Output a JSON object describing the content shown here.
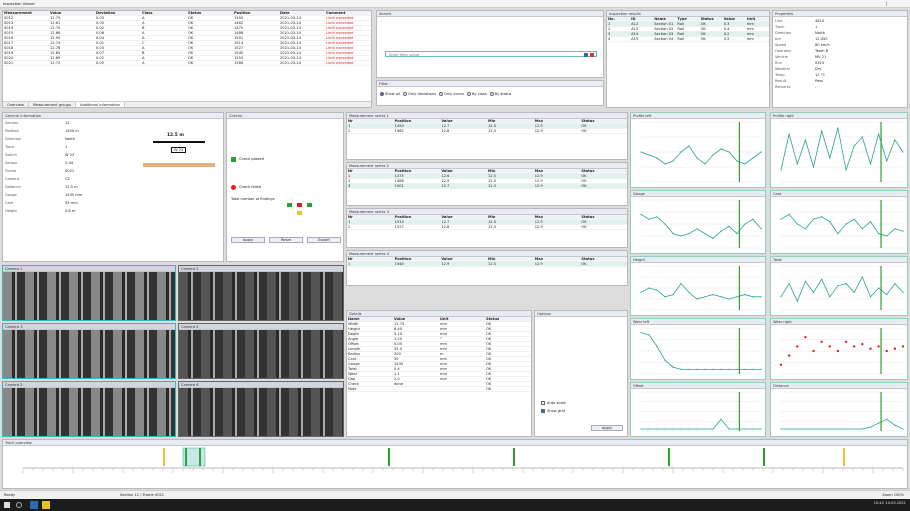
{
  "window": {
    "title": "Inspection Viewer"
  },
  "colors": {
    "teal": "#2aa391",
    "red": "#e02020",
    "green": "#2ca02c",
    "accent": "#2b6cb0"
  },
  "main_table": {
    "headers": [
      "Measurement",
      "Value",
      "Deviation",
      "Class",
      "Status",
      "Position",
      "Date",
      "Comment"
    ],
    "rows": [
      [
        "0012",
        "12.75",
        "0.03",
        "A",
        "OK",
        "1450",
        "2021-03-14",
        "Limit exceeded"
      ],
      [
        "0013",
        "12.81",
        "0.05",
        "A",
        "OK",
        "1462",
        "2021-03-14",
        "Limit exceeded"
      ],
      [
        "0014",
        "12.70",
        "0.02",
        "B",
        "OK",
        "1475",
        "2021-03-14",
        "Limit exceeded"
      ],
      [
        "0015",
        "12.66",
        "0.06",
        "A",
        "OK",
        "1488",
        "2021-03-14",
        "Limit exceeded"
      ],
      [
        "0016",
        "12.90",
        "0.04",
        "A",
        "OK",
        "1501",
        "2021-03-14",
        "Limit exceeded"
      ],
      [
        "0017",
        "12.74",
        "0.01",
        "C",
        "OK",
        "1514",
        "2021-03-14",
        "Limit exceeded"
      ],
      [
        "0018",
        "12.78",
        "0.03",
        "A",
        "OK",
        "1527",
        "2021-03-14",
        "Limit exceeded"
      ],
      [
        "0019",
        "12.85",
        "0.07",
        "B",
        "OK",
        "1540",
        "2021-03-14",
        "Limit exceeded"
      ],
      [
        "0020",
        "12.69",
        "0.02",
        "A",
        "OK",
        "1553",
        "2021-03-14",
        "Limit exceeded"
      ],
      [
        "0021",
        "12.72",
        "0.05",
        "A",
        "OK",
        "1566",
        "2021-03-14",
        "Limit exceeded"
      ]
    ],
    "tabs": [
      "Overview",
      "Measurement groups",
      "Additional information"
    ]
  },
  "search": {
    "title": "Search",
    "placeholder": "Enter filter value"
  },
  "filter_bar": {
    "title": "Filter",
    "options": [
      "Show all",
      "Only deviations",
      "Only errors",
      "By class",
      "By status"
    ]
  },
  "right_list": {
    "title": "Inspection results",
    "headers": [
      "No.",
      "ID",
      "Name",
      "Type",
      "Status",
      "Value",
      "Unit"
    ],
    "rows": [
      [
        "1",
        "A12",
        "Section 01",
        "Rail",
        "OK",
        "0.3",
        "mm"
      ],
      [
        "2",
        "A13",
        "Section 02",
        "Rail",
        "OK",
        "0.4",
        "mm"
      ],
      [
        "3",
        "A14",
        "Section 03",
        "Rail",
        "OK",
        "0.2",
        "mm"
      ],
      [
        "4",
        "A15",
        "Section 04",
        "Rail",
        "OK",
        "0.5",
        "mm"
      ]
    ]
  },
  "properties": {
    "title": "Properties",
    "items": [
      [
        "Line",
        "4810"
      ],
      [
        "Track",
        "1"
      ],
      [
        "Direction",
        "North"
      ],
      [
        "Km",
        "12.450"
      ],
      [
        "Speed",
        "80 km/h"
      ],
      [
        "Operator",
        "Team B"
      ],
      [
        "Vehicle",
        "MV 21"
      ],
      [
        "Run",
        "0315"
      ],
      [
        "Weather",
        "Dry"
      ],
      [
        "Temp.",
        "12 °C"
      ],
      [
        "Result",
        "Pass"
      ],
      [
        "Remarks",
        "-"
      ]
    ]
  },
  "info_panel": {
    "title": "General information",
    "items": [
      [
        "Section",
        "12"
      ],
      [
        "Position",
        "1450 m"
      ],
      [
        "Direction",
        "North"
      ],
      [
        "Track",
        "1"
      ],
      [
        "Switch",
        "W 23"
      ],
      [
        "Sensor",
        "S-04"
      ],
      [
        "Frame",
        "0021"
      ],
      [
        "Camera",
        "C2"
      ],
      [
        "Distance",
        "12.5 m"
      ],
      [
        "Gauge",
        "1435 mm"
      ],
      [
        "Cant",
        "35 mm"
      ],
      [
        "Height",
        "0.8 m"
      ]
    ],
    "distance_label": "12.5 m",
    "switch_label": "W 23"
  },
  "check_panel": {
    "title": "Checks",
    "ok_label": "Check passed",
    "warn_label": "Check failed",
    "summary_label": "Total number of findings",
    "button_a": "Apply",
    "button_b": "Reset",
    "button_c": "Export"
  },
  "mid_tables": [
    {
      "title": "Measurement series 1",
      "headers": [
        "Nr",
        "Position",
        "Value",
        "Min",
        "Max",
        "Status"
      ],
      "rows": [
        [
          "1",
          "1450",
          "12.7",
          "12.5",
          "12.9",
          "OK"
        ],
        [
          "2",
          "1462",
          "12.8",
          "12.5",
          "12.9",
          "OK"
        ]
      ]
    },
    {
      "title": "Measurement series 2",
      "headers": [
        "Nr",
        "Position",
        "Value",
        "Min",
        "Max",
        "Status"
      ],
      "rows": [
        [
          "1",
          "1475",
          "12.6",
          "12.5",
          "12.9",
          "OK"
        ],
        [
          "2",
          "1488",
          "12.9",
          "12.5",
          "12.9",
          "OK"
        ],
        [
          "3",
          "1501",
          "12.7",
          "12.5",
          "12.9",
          "OK"
        ]
      ]
    },
    {
      "title": "Measurement series 3",
      "headers": [
        "Nr",
        "Position",
        "Value",
        "Min",
        "Max",
        "Status"
      ],
      "rows": [
        [
          "1",
          "1514",
          "12.7",
          "12.5",
          "12.9",
          "OK"
        ],
        [
          "2",
          "1527",
          "12.8",
          "12.5",
          "12.9",
          "OK"
        ]
      ]
    },
    {
      "title": "Measurement series 4",
      "headers": [
        "Nr",
        "Position",
        "Value",
        "Min",
        "Max",
        "Status"
      ],
      "rows": [
        [
          "1",
          "1540",
          "12.9",
          "12.5",
          "12.9",
          "OK"
        ]
      ]
    }
  ],
  "bottom_table": {
    "title": "Details",
    "headers": [
      "Name",
      "Value",
      "Unit",
      "Status"
    ],
    "rows": [
      [
        "Width",
        "12.75",
        "mm",
        "OK"
      ],
      [
        "Height",
        "8.40",
        "mm",
        "OK"
      ],
      [
        "Depth",
        "3.10",
        "mm",
        "OK"
      ],
      [
        "Angle",
        "1.20",
        "°",
        "OK"
      ],
      [
        "Offset",
        "0.05",
        "mm",
        "OK"
      ],
      [
        "Length",
        "52.0",
        "mm",
        "OK"
      ],
      [
        "Radius",
        "300",
        "m",
        "OK"
      ],
      [
        "Cant",
        "35",
        "mm",
        "OK"
      ],
      [
        "Gauge",
        "1435",
        "mm",
        "OK"
      ],
      [
        "Twist",
        "0.4",
        "mm",
        "OK"
      ],
      [
        "Wear",
        "1.1",
        "mm",
        "OK"
      ],
      [
        "Gap",
        "2.0",
        "mm",
        "OK"
      ],
      [
        "Check",
        "done",
        "",
        "OK"
      ],
      [
        "Note",
        "-",
        "",
        "OK"
      ]
    ]
  },
  "options_panel": {
    "title": "Options",
    "option_a": "Auto scale",
    "option_b": "Show grid",
    "button": "Apply"
  },
  "image_titles": [
    "Camera 1",
    "Camera 2",
    "Camera 3",
    "Camera 4",
    "Camera 5",
    "Camera 6"
  ],
  "chart_titles": [
    "Profile left",
    "Profile right",
    "Gauge",
    "Cant",
    "Height",
    "Twist",
    "Wear left",
    "Wear right",
    "Offset",
    "Distance"
  ],
  "chart_data": [
    {
      "type": "line",
      "title": "Profile left",
      "values": [
        0.5,
        0.45,
        0.4,
        0.3,
        0.35,
        0.5,
        0.6,
        0.4,
        0.3,
        0.45,
        0.55,
        0.5,
        0.35,
        0.3,
        0.4,
        0.5
      ]
    },
    {
      "type": "line",
      "title": "Profile right",
      "values": [
        0.2,
        0.8,
        0.3,
        0.7,
        0.25,
        0.85,
        0.4,
        0.9,
        0.2,
        0.6,
        0.75,
        0.3,
        0.8,
        0.35,
        0.7,
        0.5
      ]
    },
    {
      "type": "line",
      "title": "Gauge",
      "values": [
        0.7,
        0.6,
        0.65,
        0.5,
        0.3,
        0.25,
        0.3,
        0.4,
        0.3,
        0.2,
        0.35,
        0.45,
        0.3,
        0.5,
        0.6,
        0.4
      ]
    },
    {
      "type": "line",
      "title": "Cant",
      "values": [
        0.6,
        0.7,
        0.5,
        0.4,
        0.6,
        0.65,
        0.55,
        0.3,
        0.5,
        0.6,
        0.4,
        0.55,
        0.3,
        0.25,
        0.4,
        0.35
      ]
    },
    {
      "type": "line",
      "title": "Height",
      "values": [
        0.4,
        0.5,
        0.45,
        0.3,
        0.35,
        0.6,
        0.4,
        0.25,
        0.3,
        0.35,
        0.3,
        0.25,
        0.3,
        0.35,
        0.3,
        0.3
      ]
    },
    {
      "type": "line",
      "title": "Twist",
      "values": [
        0.3,
        0.6,
        0.2,
        0.65,
        0.4,
        0.7,
        0.3,
        0.55,
        0.6,
        0.4,
        0.75,
        0.3,
        0.5,
        0.35,
        0.6,
        0.4
      ]
    },
    {
      "type": "line",
      "title": "Wear left",
      "values": [
        0.9,
        0.85,
        0.6,
        0.3,
        0.15,
        0.1,
        0.1,
        0.1,
        0.1,
        0.1,
        0.1,
        0.1,
        0.1,
        0.1,
        0.1,
        0.1
      ]
    },
    {
      "type": "scatter",
      "title": "Wear right",
      "values": [
        0.2,
        0.4,
        0.6,
        0.8,
        0.5,
        0.7,
        0.6,
        0.5,
        0.7,
        0.6,
        0.65,
        0.55,
        0.6,
        0.5,
        0.55,
        0.6
      ]
    },
    {
      "type": "line",
      "title": "Offset",
      "values": [
        0.05,
        0.05,
        0.05,
        0.05,
        0.05,
        0.05,
        0.05,
        0.05,
        0.05,
        0.05,
        0.3,
        0.05,
        0.05,
        0.05,
        0.05,
        0.05
      ]
    },
    {
      "type": "line",
      "title": "Distance",
      "values": [
        0.05,
        0.05,
        0.05,
        0.05,
        0.05,
        0.05,
        0.05,
        0.05,
        0.05,
        0.05,
        0.05,
        0.1,
        0.2,
        0.3,
        0.15,
        0.05
      ]
    }
  ],
  "timeline": {
    "title": "Track overview"
  },
  "statusbar": {
    "left": "Ready",
    "middle": "Section 12 / Frame 0021",
    "right": "Zoom 100%"
  },
  "taskbar": {
    "clock": "10:42",
    "date": "14.03.2021"
  }
}
